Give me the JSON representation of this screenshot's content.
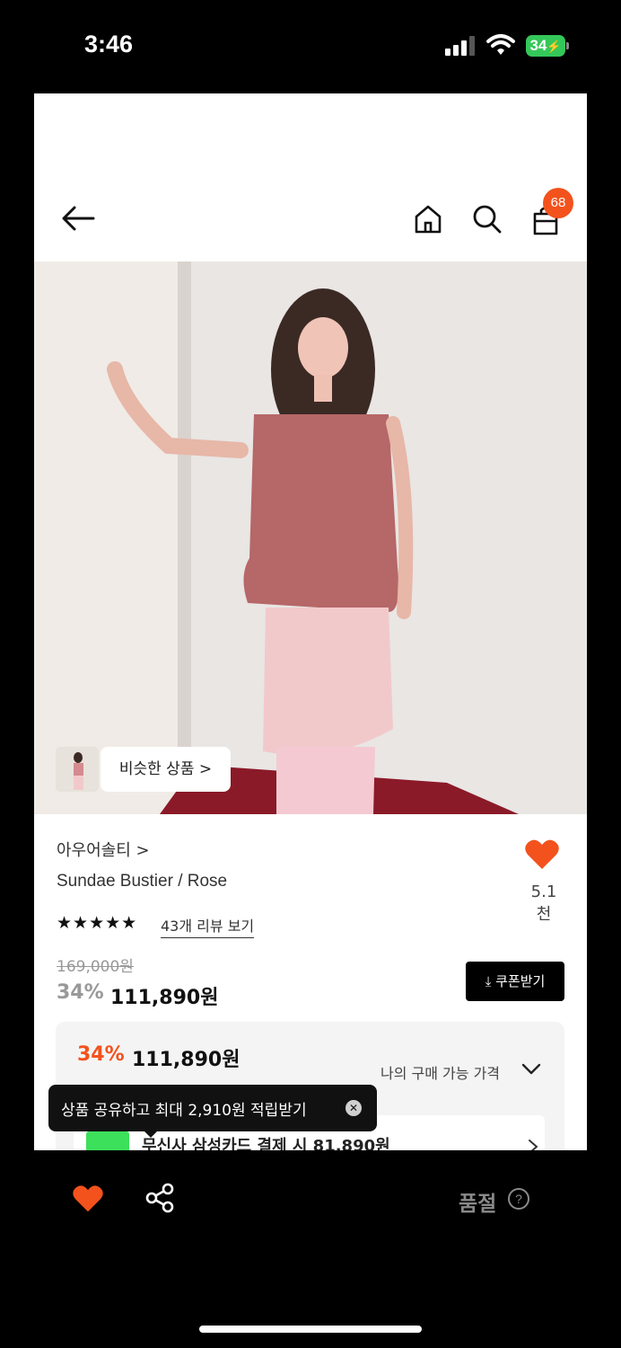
{
  "status_bar": {
    "time": "3:46",
    "battery": "34"
  },
  "header": {
    "cart_count": "68"
  },
  "hero": {
    "similar_label": "비슷한 상품 >"
  },
  "product": {
    "brand": "아우어솔티 >",
    "name": "Sundae Bustier / Rose",
    "likes": "5.1천",
    "rating_stars": "★★★★★",
    "review_link": "43개 리뷰 보기",
    "original_price": "169,000원",
    "discount": "34%",
    "sale_price": "111,890원",
    "coupon_button": "쿠폰받기"
  },
  "price_box": {
    "discount": "34%",
    "price": "111,890원",
    "my_price_label": "나의 구매 가능 가격",
    "card_offer": "무신사 삼성카드 결제 시 81,890원"
  },
  "toast": {
    "text": "상품 공유하고 최대 2,910원 적립받기"
  },
  "bottom_bar": {
    "status": "품절",
    "help": "?"
  },
  "colors": {
    "accent": "#f3521d",
    "black": "#000000",
    "badge": "#f3521d"
  }
}
